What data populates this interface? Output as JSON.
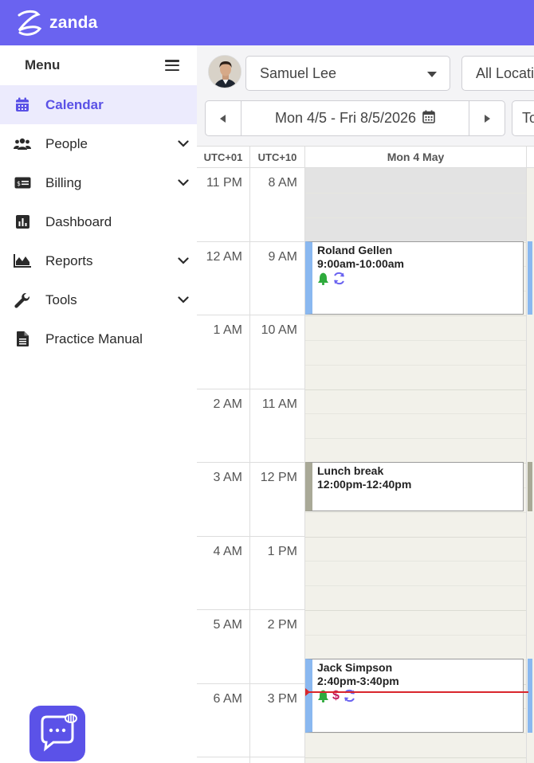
{
  "app": {
    "brand": "zanda",
    "brand_color": "#6a63f0"
  },
  "sidebar": {
    "title": "Menu",
    "items": [
      {
        "label": "Calendar",
        "icon": "calendar-icon",
        "active": true,
        "expandable": false
      },
      {
        "label": "People",
        "icon": "people-icon",
        "active": false,
        "expandable": true
      },
      {
        "label": "Billing",
        "icon": "billing-icon",
        "active": false,
        "expandable": true
      },
      {
        "label": "Dashboard",
        "icon": "dashboard-icon",
        "active": false,
        "expandable": false
      },
      {
        "label": "Reports",
        "icon": "reports-icon",
        "active": false,
        "expandable": true
      },
      {
        "label": "Tools",
        "icon": "wrench-icon",
        "active": false,
        "expandable": true
      },
      {
        "label": "Practice Manual",
        "icon": "document-icon",
        "active": false,
        "expandable": false
      }
    ]
  },
  "toolbar": {
    "staff_select": "Samuel Lee",
    "location_select": "All Locations",
    "date_range": "Mon 4/5 - Fri 8/5/2026",
    "today_button": "Today"
  },
  "calendar": {
    "tz_left": "UTC+01",
    "tz_right": "UTC+10",
    "day_header": "Mon 4 May",
    "times_left": [
      "11 PM",
      "12 AM",
      "1 AM",
      "2 AM",
      "3 AM",
      "4 AM",
      "5 AM",
      "6 AM"
    ],
    "times_right": [
      "8 AM",
      "9 AM",
      "10 AM",
      "11 AM",
      "12 PM",
      "1 PM",
      "2 PM",
      "3 PM"
    ],
    "events": [
      {
        "title": "Roland Gellen",
        "time": "9:00am-10:00am"
      },
      {
        "title": "Lunch break",
        "time": "12:00pm-12:40pm"
      },
      {
        "title": "Jack Simpson",
        "time": "2:40pm-3:40pm"
      }
    ]
  },
  "colors": {
    "accent": "#5a51e6",
    "event_blue": "#8ab8f0",
    "event_grey": "#a9a997",
    "now_line": "#d9262c",
    "bell_green": "#2eaa3c",
    "dollar_red": "#c2185b",
    "recur_purple": "#6a63f0"
  }
}
